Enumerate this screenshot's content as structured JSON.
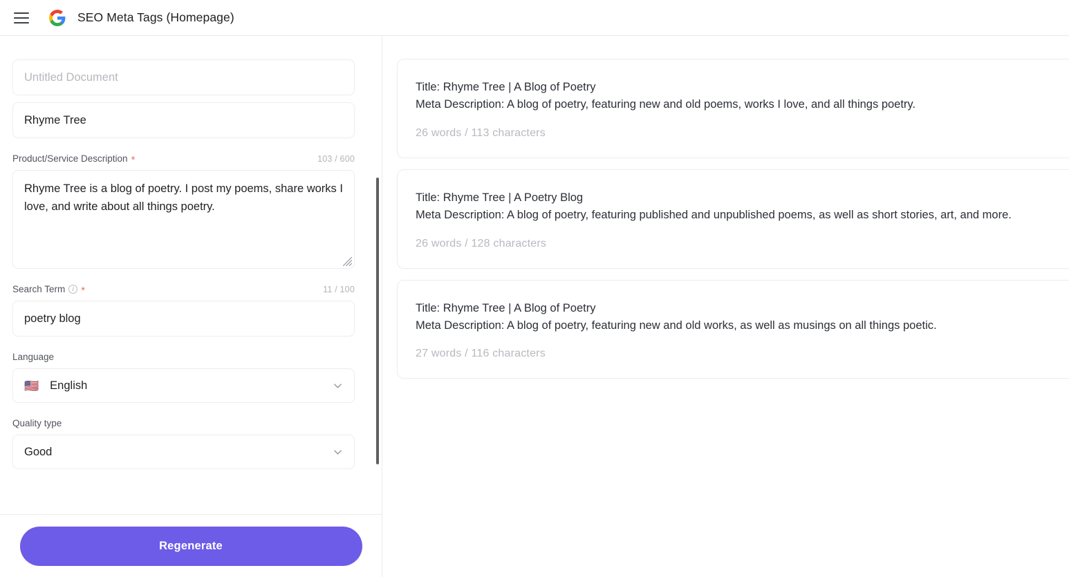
{
  "topbar": {
    "menu_icon": "hamburger-icon",
    "logo_icon": "google-logo-icon",
    "title": "SEO Meta Tags (Homepage)"
  },
  "form": {
    "document_title": {
      "value": "",
      "placeholder": "Untitled Document"
    },
    "brand_name": {
      "value": "Rhyme Tree",
      "placeholder": ""
    },
    "description": {
      "label": "Product/Service Description",
      "required_marker": "*",
      "counter": "103 / 600",
      "value": "Rhyme Tree is a blog of poetry. I post my poems, share works I love, and write about all things poetry."
    },
    "search_term": {
      "label": "Search Term",
      "info_icon": "info-icon",
      "info_glyph": "i",
      "required_marker": "*",
      "counter": "11 / 100",
      "value": "poetry blog",
      "placeholder": ""
    },
    "language": {
      "label": "Language",
      "flag": "🇺🇸",
      "value": "English",
      "chevron_icon": "chevron-down-icon"
    },
    "quality_type": {
      "label": "Quality type",
      "value": "Good",
      "chevron_icon": "chevron-down-icon"
    },
    "regenerate_label": "Regenerate"
  },
  "results": [
    {
      "title_line": "Title: Rhyme Tree | A Blog of Poetry",
      "meta_line": "Meta Description: A blog of poetry, featuring new and old poems, works I love, and all things poetry.",
      "stats": "26 words / 113 characters"
    },
    {
      "title_line": "Title: Rhyme Tree | A Poetry Blog",
      "meta_line": "Meta Description: A blog of poetry, featuring published and unpublished poems, as well as short stories, art, and more.",
      "stats": "26 words / 128 characters"
    },
    {
      "title_line": "Title: Rhyme Tree | A Blog of Poetry",
      "meta_line": "Meta Description: A blog of poetry, featuring new and old works, as well as musings on all things poetic.",
      "stats": "27 words / 116 characters"
    }
  ],
  "colors": {
    "accent": "#6C5CE7",
    "required": "#E8716A",
    "border": "#ECECEC",
    "muted_text": "#B7B9BF"
  }
}
